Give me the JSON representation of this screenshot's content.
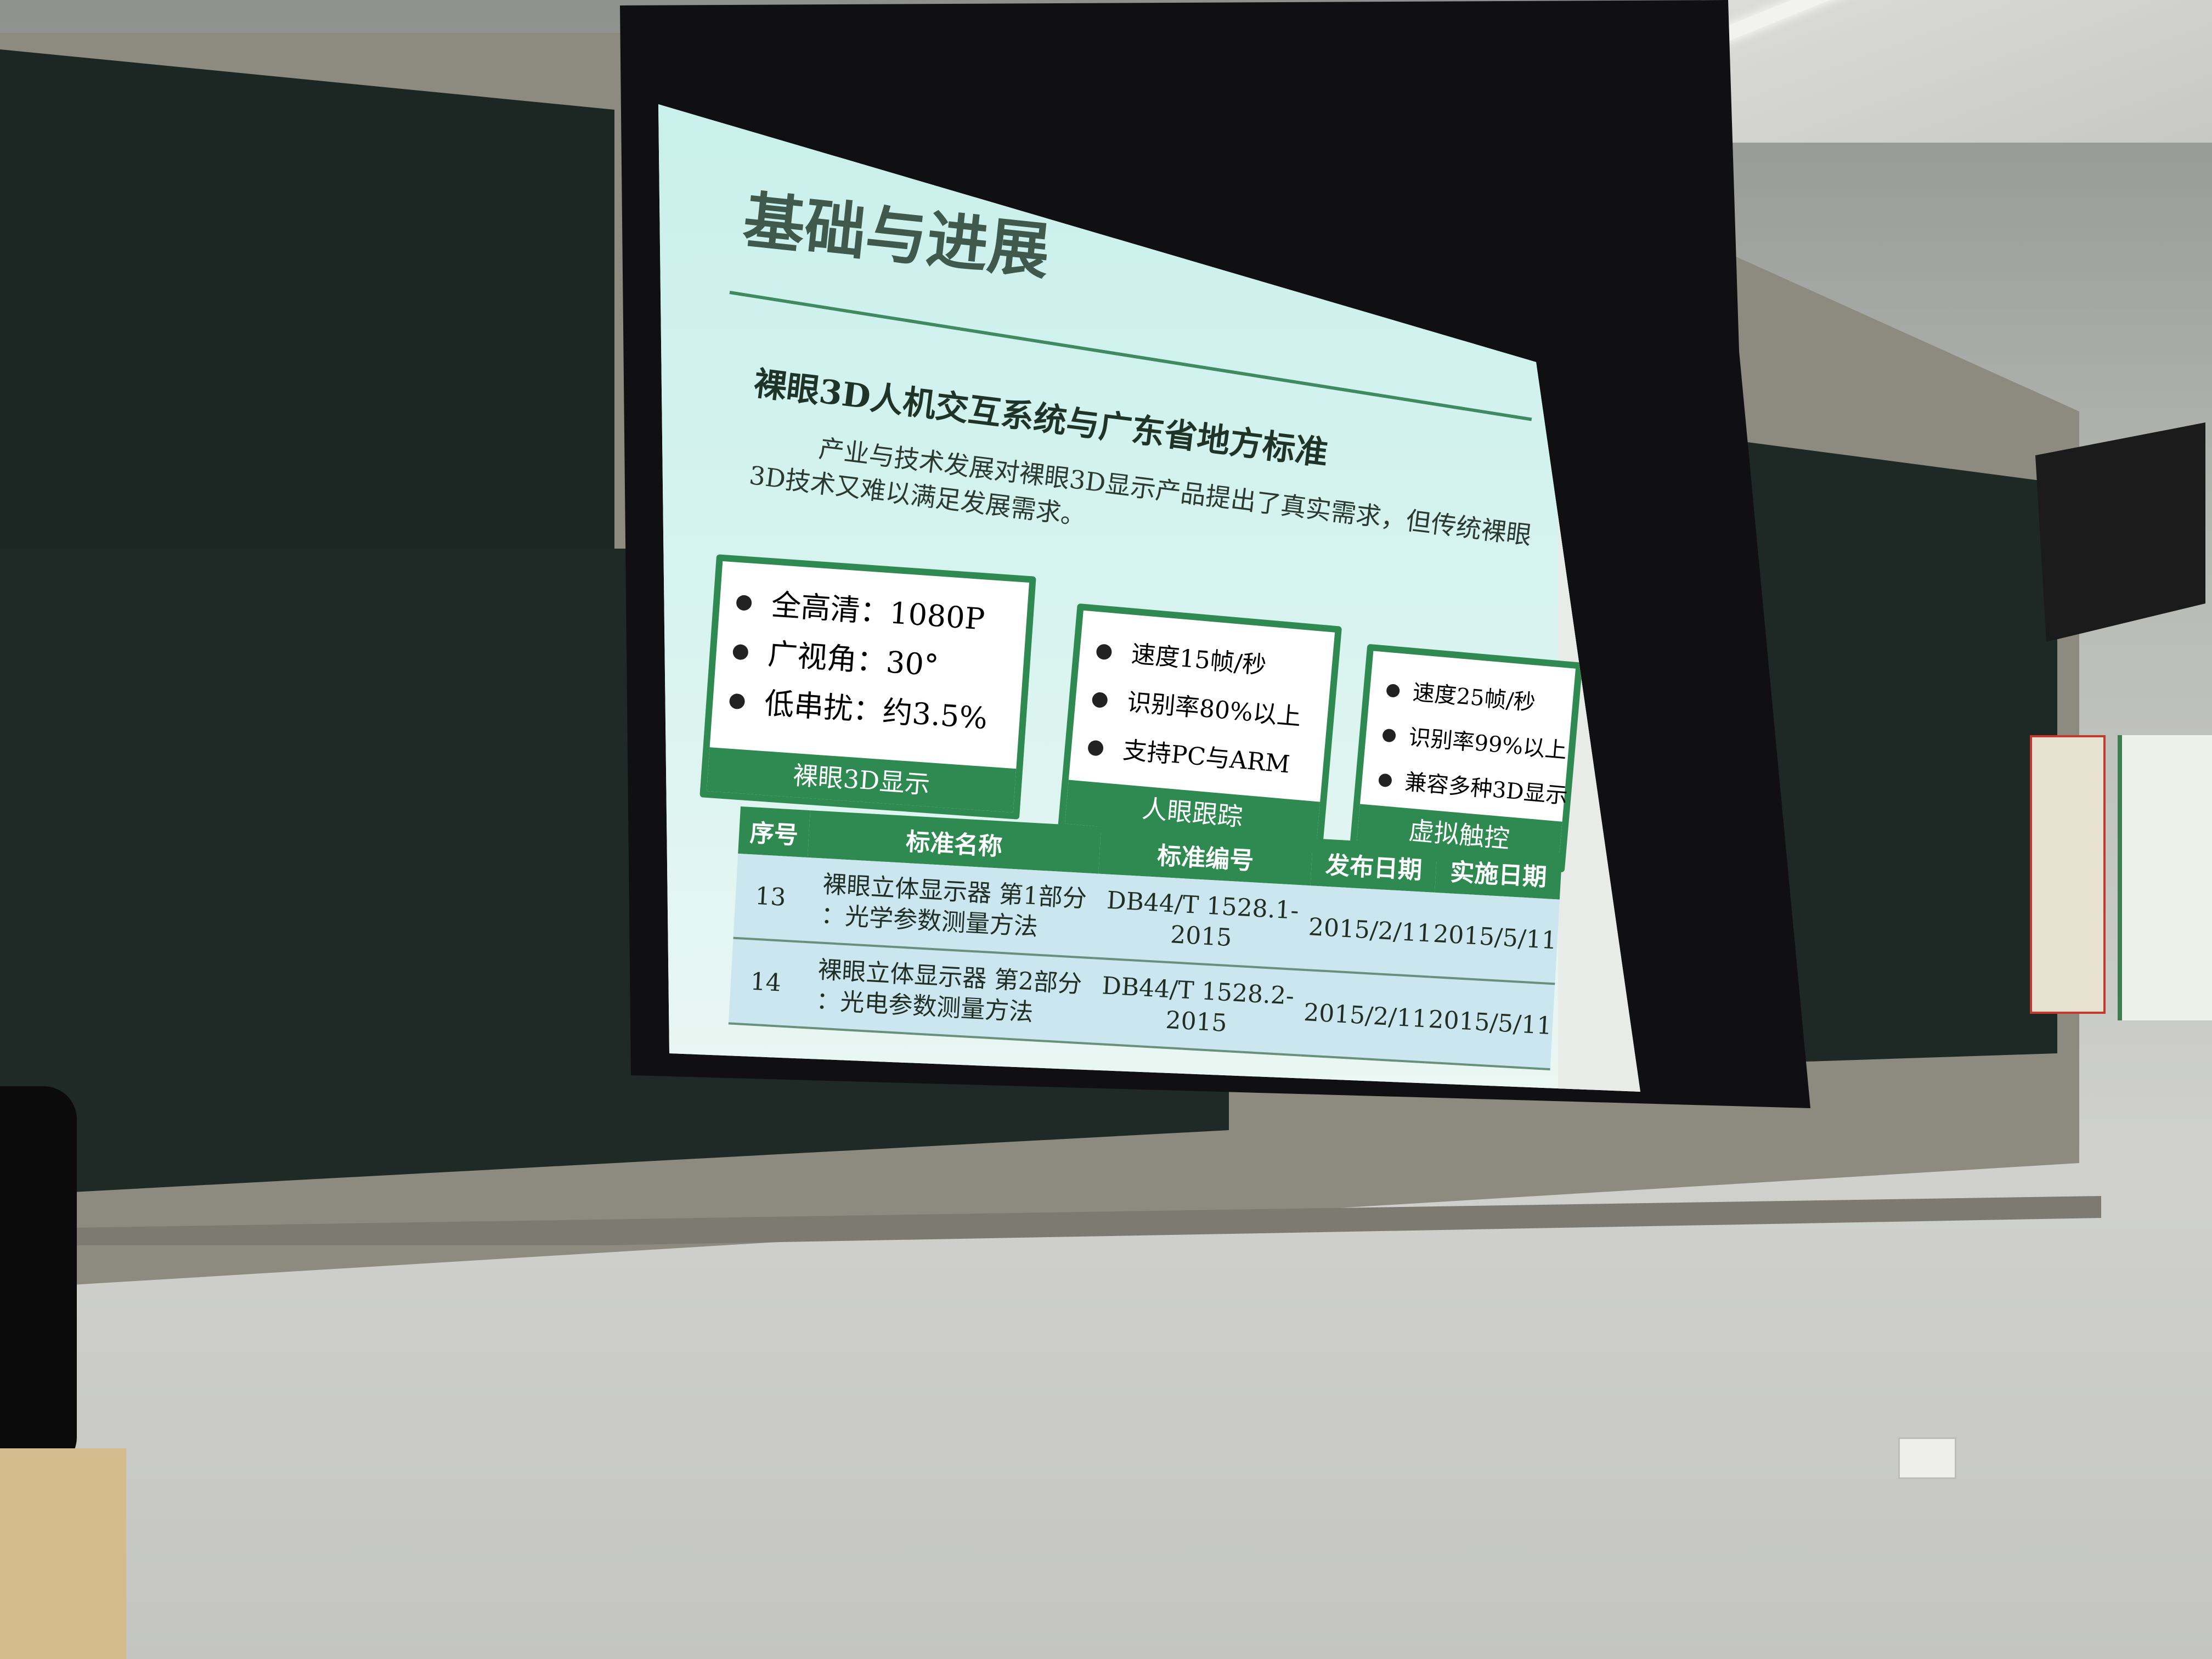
{
  "slide": {
    "title": "基础与进展",
    "subtitle": "裸眼3D人机交互系统与广东省地方标准",
    "paragraph": [
      "产业与技术发展对裸眼3D显示产品提出了真实需求，但传统裸眼",
      "3D技术又难以满足发展需求。"
    ],
    "boxes": [
      {
        "items": [
          "全高清：1080P",
          "广视角：30°",
          "低串扰：约3.5%"
        ],
        "caption": "裸眼3D显示"
      },
      {
        "items": [
          "速度15帧/秒",
          "识别率80%以上",
          "支持PC与ARM"
        ],
        "caption": "人眼跟踪"
      },
      {
        "items": [
          "速度25帧/秒",
          "识别率99%以上",
          "兼容多种3D显示"
        ],
        "caption": "虚拟触控"
      }
    ],
    "table": {
      "headers": [
        "序号",
        "标准名称",
        "标准编号",
        "发布日期",
        "实施日期"
      ],
      "rows": [
        {
          "no": "13",
          "name_line1": "裸眼立体显示器 第1部分",
          "name_line2": "：光学参数测量方法",
          "code": "DB44/T 1528.1-2015",
          "publish": "2015/2/11",
          "implement": "2015/5/11"
        },
        {
          "no": "14",
          "name_line1": "裸眼立体显示器 第2部分",
          "name_line2": "：光电参数测量方法",
          "code": "DB44/T 1528.2-2015",
          "publish": "2015/2/11",
          "implement": "2015/5/11"
        }
      ]
    }
  },
  "colors": {
    "slide_green": "#2f8a52",
    "slide_background": "#d7f3ef",
    "blackboard": "#1c2622"
  }
}
